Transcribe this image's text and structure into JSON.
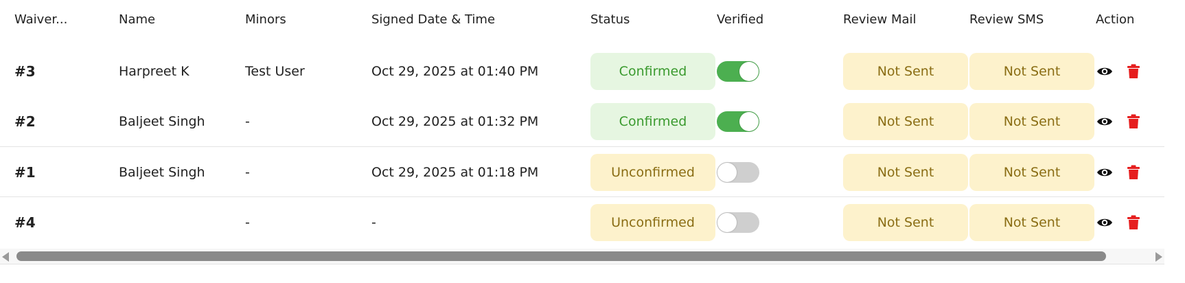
{
  "table": {
    "headers": {
      "waiver": "Waiver...",
      "name": "Name",
      "minors": "Minors",
      "signed": "Signed Date & Time",
      "status": "Status",
      "verified": "Verified",
      "review_mail": "Review Mail",
      "review_sms": "Review SMS",
      "action": "Action"
    },
    "rows": [
      {
        "id": "#3",
        "name": "Harpreet K",
        "minors": "Test User",
        "signed": "Oct 29, 2025 at 01:40 PM",
        "status": "Confirmed",
        "verified": true,
        "review_mail": "Not Sent",
        "review_sms": "Not Sent"
      },
      {
        "id": "#2",
        "name": "Baljeet Singh",
        "minors": "-",
        "signed": "Oct 29, 2025 at 01:32 PM",
        "status": "Confirmed",
        "verified": true,
        "review_mail": "Not Sent",
        "review_sms": "Not Sent"
      },
      {
        "id": "#1",
        "name": "Baljeet Singh",
        "minors": "-",
        "signed": "Oct 29, 2025 at 01:18 PM",
        "status": "Unconfirmed",
        "verified": false,
        "review_mail": "Not Sent",
        "review_sms": "Not Sent"
      },
      {
        "id": "#4",
        "name": "",
        "minors": "-",
        "signed": "-",
        "status": "Unconfirmed",
        "verified": false,
        "review_mail": "Not Sent",
        "review_sms": "Not Sent"
      }
    ]
  },
  "icons": {
    "view": "eye-icon",
    "delete": "trash-icon"
  },
  "colors": {
    "confirmed_bg": "#e6f6e1",
    "confirmed_text": "#3a9a2e",
    "pending_bg": "#fdf2cc",
    "pending_text": "#8a6d14",
    "toggle_on": "#4caf50",
    "toggle_off": "#cfcfcf",
    "delete_icon": "#e61e1e"
  }
}
